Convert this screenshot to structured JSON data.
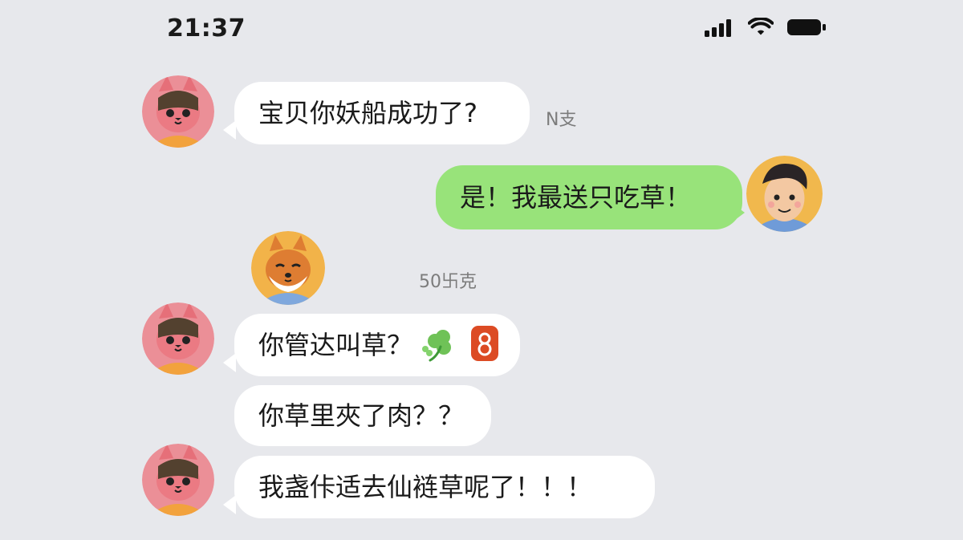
{
  "status_bar": {
    "time": "21:37",
    "signal_icon": "signal-icon",
    "wifi_icon": "wifi-icon",
    "battery_icon": "battery-icon"
  },
  "messages": [
    {
      "sender": "cat",
      "side": "left",
      "text": "宝贝你妖船成功了?",
      "meta": "N支"
    },
    {
      "sender": "boy",
      "side": "right",
      "text": "是！我最送只吃草！"
    },
    {
      "sender": "shiba",
      "side": "left",
      "meta": "50卐克"
    },
    {
      "sender": "cat",
      "side": "left",
      "text": "你管达叫草？",
      "stickers": [
        "clover-sticker-icon",
        "red-badge-sticker-icon"
      ]
    },
    {
      "sender": "cat",
      "side": "left",
      "text": "你草里夾了肉？？"
    },
    {
      "sender": "cat",
      "side": "left",
      "text": "我盏佧适去仙裢草呢了！！！"
    }
  ],
  "colors": {
    "background": "#e7e8ec",
    "bubble_white": "#ffffff",
    "bubble_green": "#98e37a",
    "meta_text": "#7c7c7c"
  }
}
